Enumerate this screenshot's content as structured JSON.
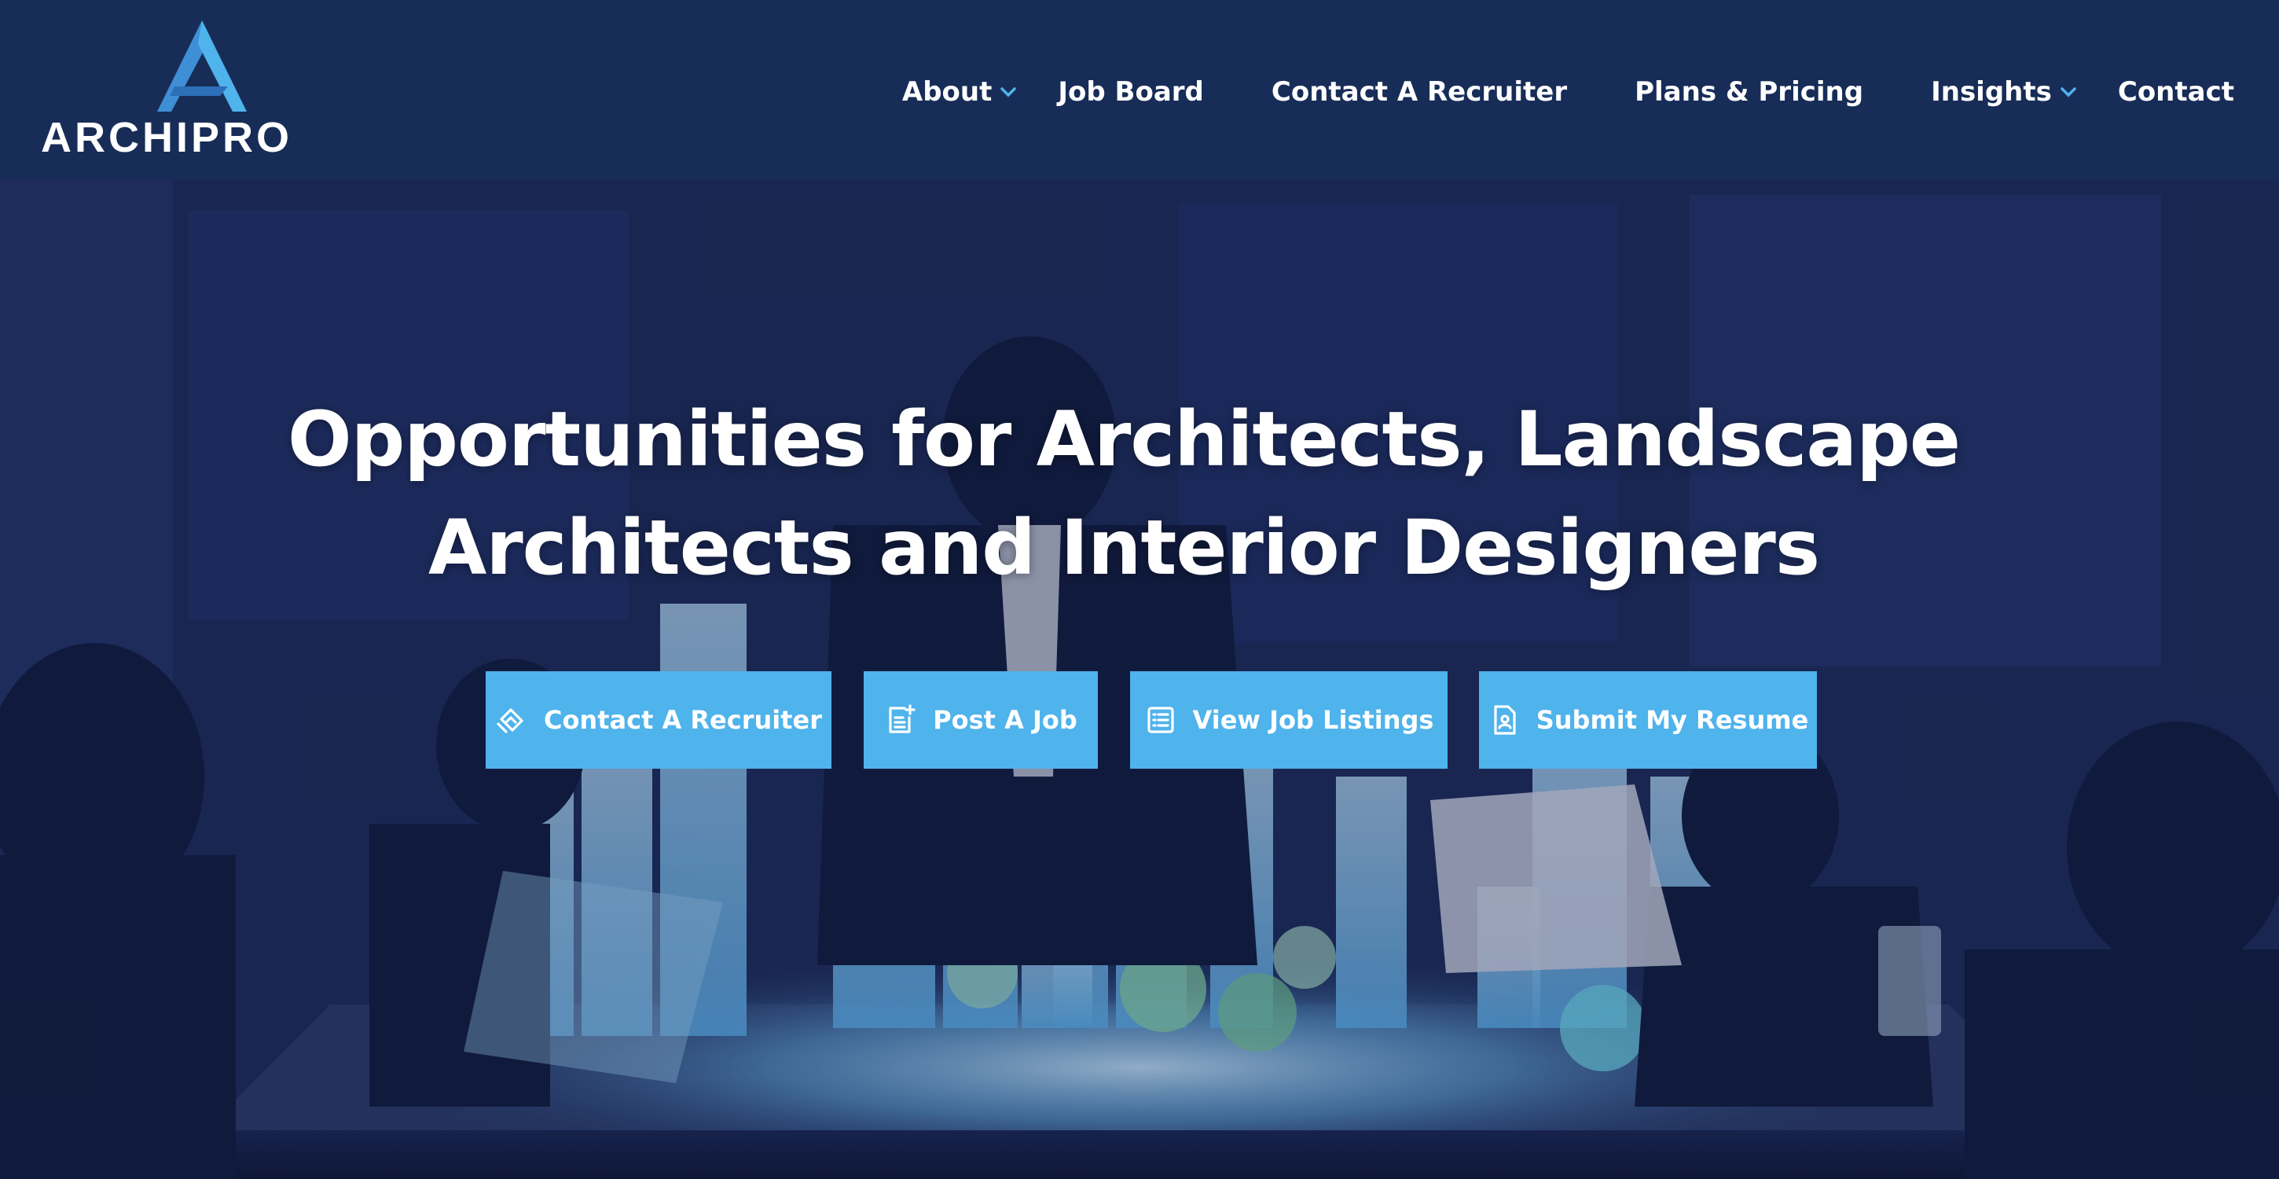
{
  "brand": {
    "name": "ARCHIPRO",
    "accent": "#4fb3ec",
    "header_bg": "#172d58",
    "logo_icon": "archipro-a-logo"
  },
  "nav": {
    "items": [
      {
        "label": "About",
        "has_dropdown": true,
        "icon": "chevron-down-icon"
      },
      {
        "label": "Job Board",
        "has_dropdown": false
      },
      {
        "label": "Contact A Recruiter",
        "has_dropdown": false
      },
      {
        "label": "Plans & Pricing",
        "has_dropdown": false
      },
      {
        "label": "Insights",
        "has_dropdown": true,
        "icon": "chevron-down-icon"
      },
      {
        "label": "Contact",
        "has_dropdown": false
      }
    ]
  },
  "hero": {
    "title_line1": "Opportunities for Architects, Landscape",
    "title_line2": "Architects and Interior Designers",
    "background": "team-around-holographic-city-model",
    "ctas": [
      {
        "label": "Contact A Recruiter",
        "icon": "handshake-icon"
      },
      {
        "label": "Post A Job",
        "icon": "add-document-icon"
      },
      {
        "label": "View Job Listings",
        "icon": "list-icon"
      },
      {
        "label": "Submit My Resume",
        "icon": "resume-icon"
      }
    ]
  }
}
